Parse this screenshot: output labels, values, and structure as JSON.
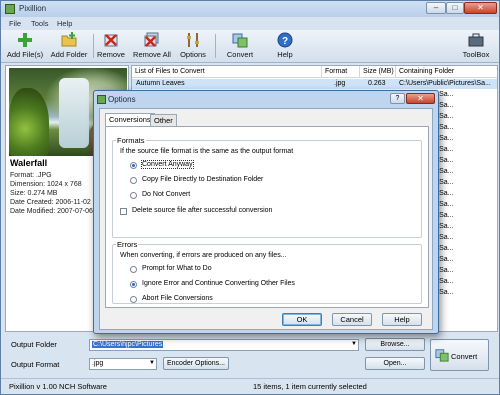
{
  "window": {
    "title": "Pixillion",
    "min_glyph": "–",
    "max_glyph": "□",
    "close_glyph": "✕"
  },
  "menu": [
    "File",
    "Tools",
    "Help"
  ],
  "toolbar": {
    "add_files": "Add File(s)",
    "add_folder": "Add Folder",
    "remove": "Remove",
    "remove_all": "Remove All",
    "options": "Options",
    "convert": "Convert",
    "help": "Help",
    "toolbox": "ToolBox"
  },
  "preview": {
    "name": "Walerfall",
    "format": "Format: .JPG",
    "dimension": "Dimension: 1024 x 768",
    "size": "Size: 0.274 MB",
    "created": "Date Created: 2006-11-02 2",
    "modified": "Date Modified: 2007-07-06 1"
  },
  "filelist": {
    "headers": [
      "List of Files to Convert",
      "Format",
      "Size (MB)",
      "Containing Folder"
    ],
    "rows": [
      {
        "name": "Autumn Leaves",
        "format": ".jpg",
        "size": "0.263",
        "folder": "C:\\Users\\Public\\Pictures\\Sa..."
      },
      {
        "name": "",
        "format": "",
        "size": "",
        "folder": "...ic\\Pictures\\Sa..."
      },
      {
        "name": "",
        "format": "",
        "size": "",
        "folder": "...ic\\Pictures\\Sa..."
      },
      {
        "name": "",
        "format": "",
        "size": "",
        "folder": "...ic\\Pictures\\Sa..."
      },
      {
        "name": "",
        "format": "",
        "size": "",
        "folder": "...ic\\Pictures\\Sa..."
      },
      {
        "name": "",
        "format": "",
        "size": "",
        "folder": "...ic\\Pictures\\Sa..."
      },
      {
        "name": "",
        "format": "",
        "size": "",
        "folder": "...ic\\Pictures\\Sa..."
      },
      {
        "name": "",
        "format": "",
        "size": "",
        "folder": "...ic\\Pictures\\Sa..."
      },
      {
        "name": "",
        "format": "",
        "size": "",
        "folder": "...ic\\Pictures\\Sa..."
      },
      {
        "name": "",
        "format": "",
        "size": "",
        "folder": "...ic\\Pictures\\Sa..."
      },
      {
        "name": "",
        "format": "",
        "size": "",
        "folder": "...ic\\Pictures\\Sa..."
      },
      {
        "name": "",
        "format": "",
        "size": "",
        "folder": "...ic\\Pictures\\Sa..."
      },
      {
        "name": "",
        "format": "",
        "size": "",
        "folder": "...ic\\Pictures\\Sa..."
      },
      {
        "name": "",
        "format": "",
        "size": "",
        "folder": "...ic\\Pictures\\Sa..."
      },
      {
        "name": "",
        "format": "",
        "size": "",
        "folder": "...ic\\Pictures\\Sa..."
      },
      {
        "name": "",
        "format": "",
        "size": "",
        "folder": "...ic\\Pictures\\Sa..."
      },
      {
        "name": "",
        "format": "",
        "size": "",
        "folder": "...ic\\Pictures\\Sa..."
      },
      {
        "name": "",
        "format": "",
        "size": "",
        "folder": "...ic\\Pictures\\Sa..."
      },
      {
        "name": "",
        "format": "",
        "size": "",
        "folder": "...ic\\Pictures\\Sa..."
      },
      {
        "name": "",
        "format": "",
        "size": "",
        "folder": "...ic\\Pictures\\Sa..."
      }
    ]
  },
  "bottom": {
    "output_folder_label": "Output Folder",
    "output_folder_value": "C:\\Users\\hjpc\\Pictures",
    "browse": "Browse...",
    "output_format_label": "Output Format",
    "output_format_value": ".jpg",
    "encoder_options": "Encoder Options...",
    "open": "Open...",
    "convert": "Convert",
    "dropdown_glyph": "▼"
  },
  "status": {
    "version": "Pixillion v 1.00  NCH Software",
    "items": "15 items, 1 item currently selected"
  },
  "dialog": {
    "title": "Options",
    "help_glyph": "?",
    "close_glyph": "✕",
    "tabs": [
      "Conversions",
      "Other"
    ],
    "formats": {
      "label": "Formats",
      "desc": "If the source file format is the same as the output format",
      "options": [
        "Convert Anyway",
        "Copy File Directly to Destination Folder",
        "Do Not Convert"
      ],
      "selected": 0
    },
    "delete_source": "Delete source file after successful conversion",
    "errors": {
      "label": "Errors",
      "desc": "When converting, if errors are produced on any files...",
      "options": [
        "Prompt for What to Do",
        "Ignore Error and Continue Converting Other Files",
        "Abort File Conversions"
      ],
      "selected": 1
    },
    "ok": "OK",
    "cancel": "Cancel",
    "help": "Help"
  },
  "colors": {
    "accent": "#3a74c8",
    "titlebar": "#cfe0f2",
    "close": "#c5452c"
  }
}
